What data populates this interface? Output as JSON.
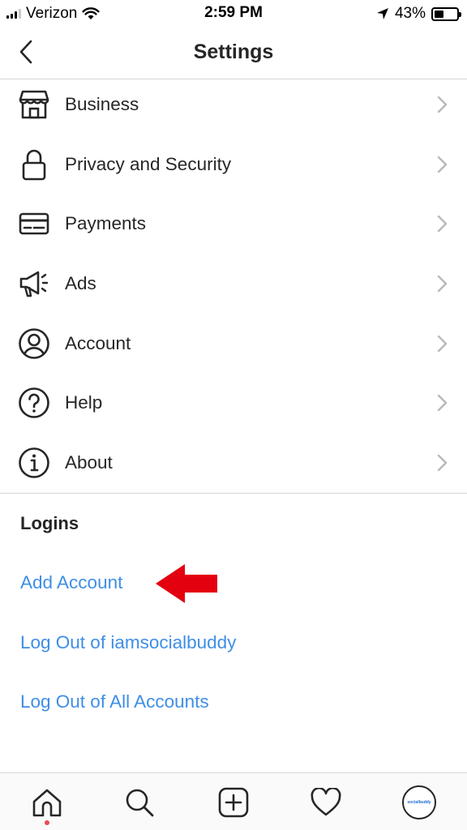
{
  "status_bar": {
    "carrier": "Verizon",
    "time": "2:59 PM",
    "battery": "43%",
    "battery_level": 0.43,
    "icons": [
      "cellular-signal-icon",
      "wifi-icon",
      "location-arrow-icon",
      "battery-icon"
    ]
  },
  "nav": {
    "title": "Settings",
    "back_icon": "chevron-left-icon"
  },
  "menu": {
    "items": [
      {
        "label": "Business",
        "icon": "storefront-icon"
      },
      {
        "label": "Privacy and Security",
        "icon": "lock-icon"
      },
      {
        "label": "Payments",
        "icon": "credit-card-icon"
      },
      {
        "label": "Ads",
        "icon": "megaphone-icon"
      },
      {
        "label": "Account",
        "icon": "user-circle-icon"
      },
      {
        "label": "Help",
        "icon": "question-circle-icon"
      },
      {
        "label": "About",
        "icon": "info-circle-icon"
      }
    ],
    "chevron_icon": "chevron-right-icon"
  },
  "logins": {
    "heading": "Logins",
    "add_account": "Add Account",
    "log_out": "Log Out of iamsocialbuddy",
    "log_out_all": "Log Out of All Accounts"
  },
  "annotation": {
    "icon": "red-arrow-icon",
    "color": "#e3000f"
  },
  "tab_bar": {
    "tabs": [
      "home-icon",
      "search-icon",
      "new-post-icon",
      "activity-heart-icon",
      "profile-avatar"
    ],
    "avatar_text": "socialbuddy"
  },
  "colors": {
    "link_blue": "#3f8ee6",
    "text": "#262626",
    "notification_dot": "#ed4956"
  }
}
